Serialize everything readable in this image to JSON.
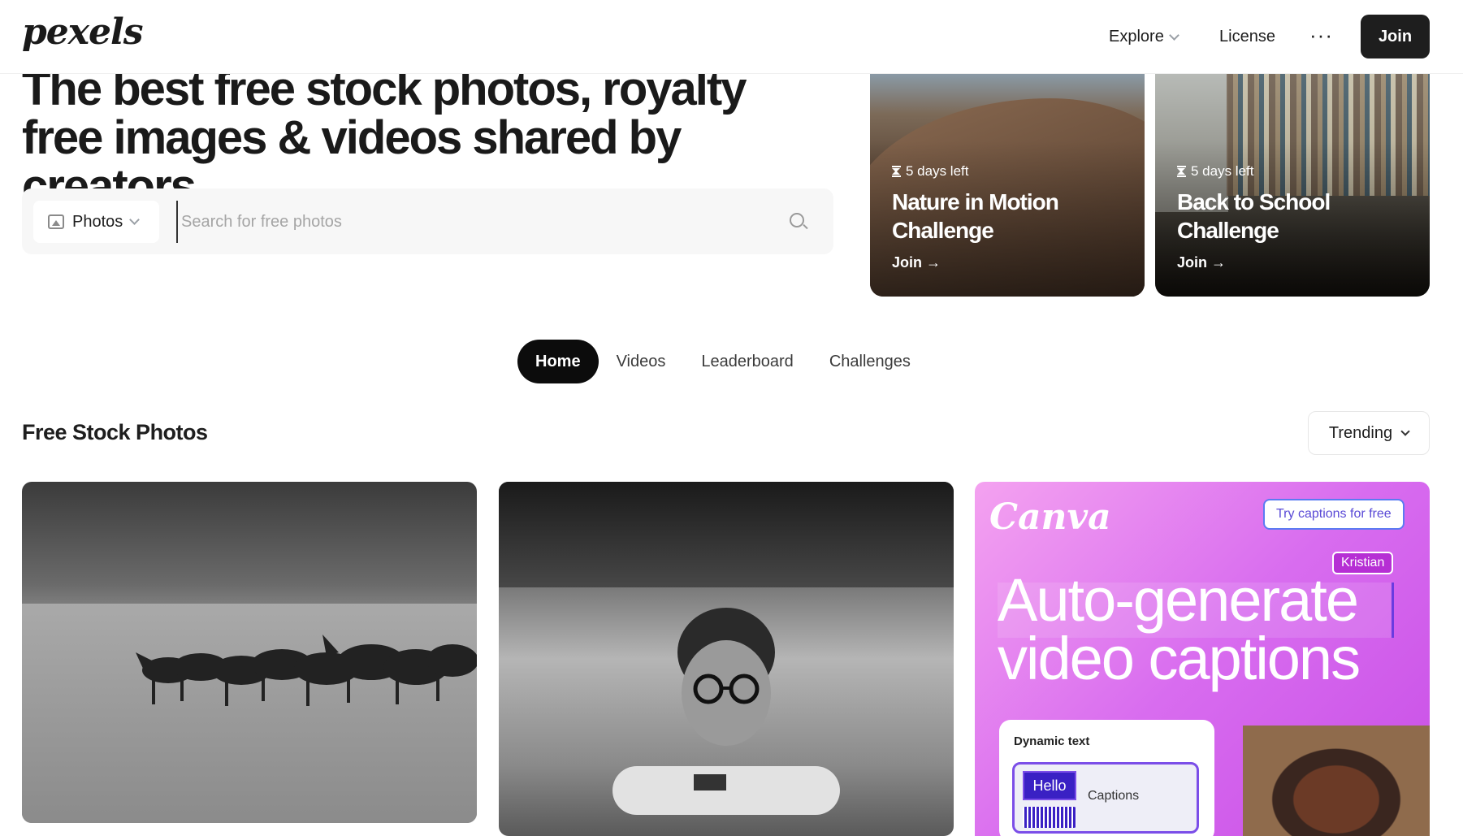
{
  "nav": {
    "logo": "pexels",
    "explore": "Explore",
    "license": "License",
    "more": "···",
    "join": "Join"
  },
  "hero": {
    "title": "The best free stock photos, royalty free images & videos shared by creators."
  },
  "search": {
    "type": "Photos",
    "placeholder": "Search for free photos"
  },
  "challenges": [
    {
      "days_left": "5 days left",
      "title": "Nature in Motion Challenge",
      "join": "Join →"
    },
    {
      "days_left": "5 days left",
      "title": "Back to School Challenge",
      "join": "Join →"
    }
  ],
  "tabs": [
    {
      "label": "Home",
      "active": true
    },
    {
      "label": "Videos",
      "active": false
    },
    {
      "label": "Leaderboard",
      "active": false
    },
    {
      "label": "Challenges",
      "active": false
    }
  ],
  "section": {
    "title": "Free Stock Photos",
    "sort": "Trending"
  },
  "ad": {
    "brand": "Canva",
    "cta": "Try captions for free",
    "name_tag": "Kristian",
    "headline": "Auto-generate video captions",
    "panel_label": "Dynamic text",
    "hello": "Hello",
    "captions": "Captions"
  },
  "colors": {
    "primary": "#0c0c0c",
    "ad_gradient_start": "#f4a2f0",
    "ad_gradient_end": "#c84ee6",
    "ad_accent": "#7b4ee8"
  }
}
